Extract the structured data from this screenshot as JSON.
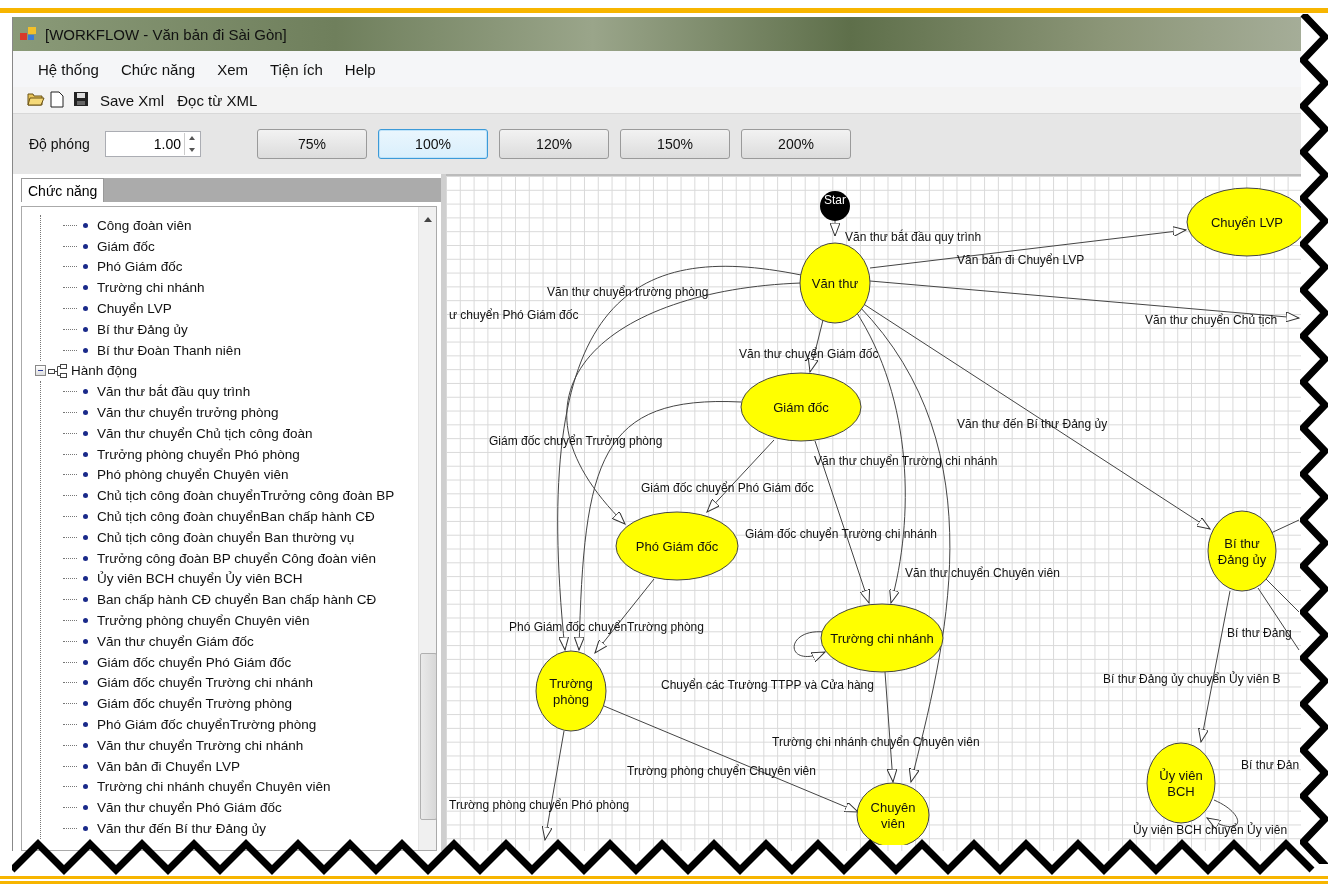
{
  "window": {
    "title": "[WORKFLOW - Văn bản đi Sài Gòn]"
  },
  "menu": [
    "Hệ thống",
    "Chức năng",
    "Xem",
    "Tiện ích",
    "Help"
  ],
  "toolbar": [
    {
      "kind": "open"
    },
    {
      "kind": "new"
    },
    {
      "kind": "save"
    },
    {
      "kind": "text",
      "label": "Save Xml"
    },
    {
      "kind": "text",
      "label": "Đọc từ XML"
    }
  ],
  "zoom": {
    "label": "Độ phóng",
    "value": "1.00",
    "presets": [
      {
        "label": "75%",
        "selected": false
      },
      {
        "label": "100%",
        "selected": true
      },
      {
        "label": "120%",
        "selected": false
      },
      {
        "label": "150%",
        "selected": false
      },
      {
        "label": "200%",
        "selected": false
      }
    ]
  },
  "side_panel": {
    "tab": "Chức năng",
    "tree": [
      {
        "children": [
          {
            "label": "Công đoàn viên"
          },
          {
            "label": "Giám đốc"
          },
          {
            "label": "Phó Giám đốc"
          },
          {
            "label": "Trường chi nhánh"
          },
          {
            "label": "Chuyển LVP"
          },
          {
            "label": "Bí thư Đảng ủy"
          },
          {
            "label": "Bí thư Đoàn Thanh niên"
          }
        ]
      },
      {
        "label": "Hành động",
        "expanded": true,
        "children": [
          {
            "label": "Văn thư bắt đầu quy trình"
          },
          {
            "label": "Văn thư chuyển trưởng phòng"
          },
          {
            "label": "Văn thư chuyển Chủ tịch công đoàn"
          },
          {
            "label": "Trưởng phòng chuyển Phó phòng"
          },
          {
            "label": "Phó phòng chuyển Chuyên viên"
          },
          {
            "label": "Chủ tịch công đoàn chuyểnTrưởng công đoàn BP"
          },
          {
            "label": "Chủ tịch công đoàn chuyểnBan chấp hành CĐ"
          },
          {
            "label": "Chủ tịch công đoàn chuyển Ban thường vụ"
          },
          {
            "label": "Trưởng công đoàn BP chuyển Công đoàn viên"
          },
          {
            "label": "Ủy viên BCH chuyển Ủy viên BCH"
          },
          {
            "label": "Ban chấp hành CĐ chuyển Ban chấp hành CĐ"
          },
          {
            "label": "Trưởng phòng chuyển Chuyên viên"
          },
          {
            "label": "Văn thư chuyển Giám đốc"
          },
          {
            "label": "Giám đốc chuyển Phó Giám đốc"
          },
          {
            "label": "Giám đốc chuyển Trường chi nhánh"
          },
          {
            "label": "Giám đốc chuyển Trường phòng"
          },
          {
            "label": "Phó Giám đốc chuyểnTrường phòng"
          },
          {
            "label": "Văn thư chuyển Trường chi nhánh"
          },
          {
            "label": "Văn bản đi Chuyển LVP"
          },
          {
            "label": "Trường chi nhánh chuyển Chuyên viên"
          },
          {
            "label": "Văn thư chuyển Phó Giám đốc"
          },
          {
            "label": "Văn thư đến Bí thư Đảng ủy"
          }
        ]
      }
    ]
  },
  "diagram": {
    "nodes": [
      {
        "kind": "start",
        "label": "Star"
      },
      {
        "kind": "state",
        "label": "Văn thư"
      },
      {
        "kind": "state",
        "label": "Chuyển LVP"
      },
      {
        "kind": "state",
        "label": "Giám đốc"
      },
      {
        "kind": "state",
        "label": "Phó Giám đốc"
      },
      {
        "kind": "state",
        "label": "Trường chi nhánh"
      },
      {
        "kind": "state",
        "label": "Trường phòng"
      },
      {
        "kind": "state",
        "label": "Chuyên viên"
      },
      {
        "kind": "state",
        "label": "Bí thư Đảng ủy"
      },
      {
        "kind": "state",
        "label": "Ủy viên BCH"
      }
    ],
    "labels": [
      "Văn thư bắt đầu quy trình",
      "Văn bản đi Chuyển LVP",
      "Văn thư chuyển trường phòng",
      "ư chuyển Phó Giám đốc",
      "Văn thư chuyển Chủ tịch",
      "Văn thư chuyển Giám đốc",
      "Văn thư đến Bí thư Đảng ủy",
      "Giám đốc chuyển Trưởng phòng",
      "Văn thư chuyển Trường chi nhánh",
      "Giám đốc chuyển Phó Giám đốc",
      "Giám đốc chuyển Trường chi nhánh",
      "Văn thư chuyển Chuyên viên",
      "Phó Giám đốc chuyểnTrường phòng",
      "Bí thư Đảng",
      "Chuyển các Trường TTPP và Cửa hàng",
      "Bí thư Đảng ủy chuyển Ủy viên B",
      "Trường chi nhánh chuyển Chuyên viên",
      "Bí thư Đản",
      "Trường phòng chuyển Chuyên viên",
      "Trường phòng chuyển Phó phòng",
      "Ủy viên BCH chuyển Ủy viên"
    ]
  }
}
